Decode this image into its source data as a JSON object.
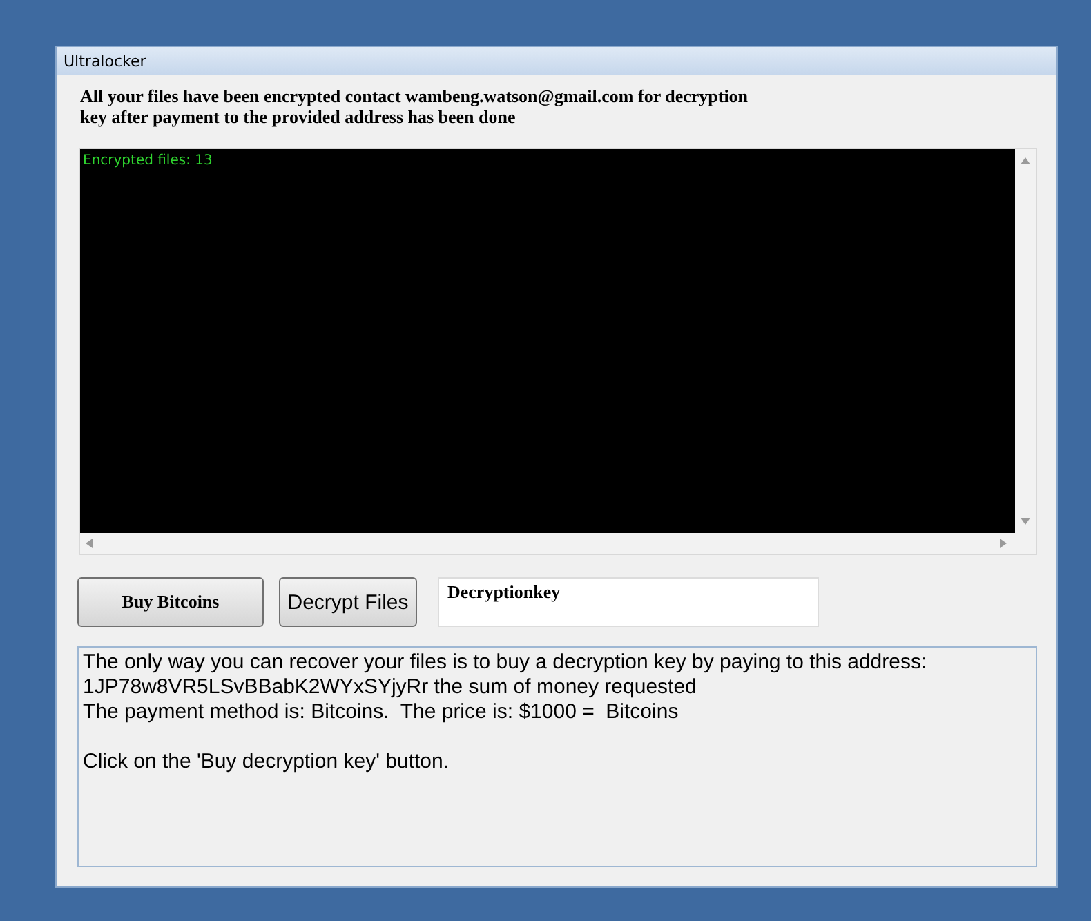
{
  "window": {
    "title": "Ultralocker"
  },
  "header": {
    "lines": [
      "All your files have been encrypted contact wambeng.watson@gmail.com for decryption",
      "key after payment to the provided address has been done"
    ]
  },
  "log": {
    "lines": [
      "Encrypted files: 13"
    ]
  },
  "buttons": [
    {
      "label": "Buy Bitcoins",
      "kind": "serif"
    },
    {
      "label": "Decrypt Files",
      "kind": "sans"
    }
  ],
  "key_field": {
    "value": "Decryptionkey"
  },
  "message": {
    "paragraphs": [
      {
        "lines": [
          "The only way you can recover your files is to buy a decryption key by paying to this address:",
          "1JP78w8VR5LSvBBabK2WYxSYjyRr the sum of money requested",
          "The payment method is: Bitcoins.  The price is: $1000 =  Bitcoins"
        ]
      },
      {
        "lines": [
          "Click on the 'Buy decryption key' button."
        ]
      }
    ]
  }
}
